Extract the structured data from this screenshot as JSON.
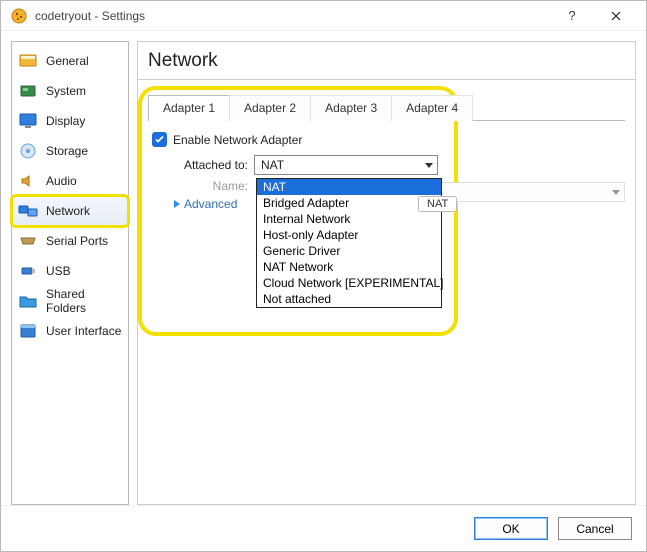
{
  "window": {
    "title": "codetryout - Settings"
  },
  "sidebar": {
    "items": [
      {
        "label": "General"
      },
      {
        "label": "System"
      },
      {
        "label": "Display"
      },
      {
        "label": "Storage"
      },
      {
        "label": "Audio"
      },
      {
        "label": "Network"
      },
      {
        "label": "Serial Ports"
      },
      {
        "label": "USB"
      },
      {
        "label": "Shared Folders"
      },
      {
        "label": "User Interface"
      }
    ],
    "selected_index": 5
  },
  "main": {
    "heading": "Network",
    "tabs": [
      {
        "label": "Adapter 1"
      },
      {
        "label": "Adapter 2"
      },
      {
        "label": "Adapter 3"
      },
      {
        "label": "Adapter 4"
      }
    ],
    "active_tab_index": 0,
    "enable_checkbox": {
      "label": "Enable Network Adapter",
      "checked": true
    },
    "attached_to": {
      "label": "Attached to:",
      "value": "NAT",
      "options": [
        "NAT",
        "Bridged Adapter",
        "Internal Network",
        "Host-only Adapter",
        "Generic Driver",
        "NAT Network",
        "Cloud Network [EXPERIMENTAL]",
        "Not attached"
      ],
      "highlighted_index": 0,
      "tooltip": "NAT"
    },
    "name": {
      "label": "Name:"
    },
    "advanced": {
      "label": "Advanced",
      "expanded": false
    }
  },
  "footer": {
    "ok": "OK",
    "cancel": "Cancel"
  }
}
